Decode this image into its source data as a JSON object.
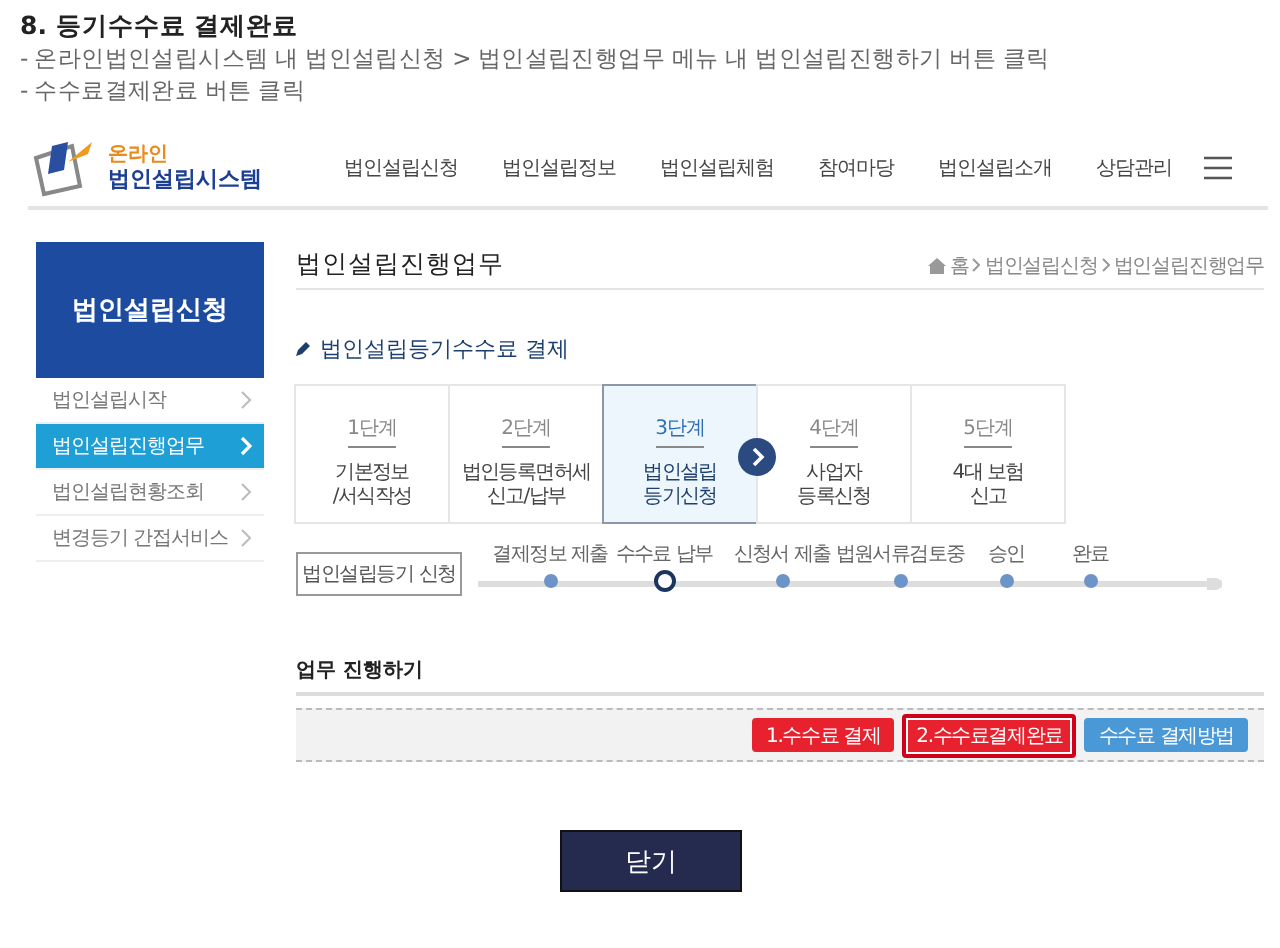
{
  "heading": "8. 등기수수료 결제완료",
  "instructions": [
    "- 온라인법인설립시스템 내 법인설립신청 > 법인설립진행업무 메뉴 내 법인설립진행하기 버튼 클릭",
    "- 수수료결제완료 버튼 클릭"
  ],
  "logo": {
    "top": "온라인",
    "bottom": "법인설립시스템"
  },
  "nav": [
    "법인설립신청",
    "법인설립정보",
    "법인설립체험",
    "참여마당",
    "법인설립소개",
    "상담관리"
  ],
  "sidebar": {
    "title": "법인설립신청",
    "items": [
      {
        "label": "법인설립시작",
        "selected": false
      },
      {
        "label": "법인설립진행업무",
        "selected": true
      },
      {
        "label": "법인설립현황조회",
        "selected": false
      },
      {
        "label": "변경등기 간접서비스",
        "selected": false
      }
    ]
  },
  "page_title": "법인설립진행업무",
  "breadcrumb": [
    "홈",
    "법인설립신청",
    "법인설립진행업무"
  ],
  "section_title": "법인설립등기수수료 결제",
  "steps": [
    {
      "number": "1단계",
      "label": [
        "기본정보",
        "/서식작성"
      ],
      "selected": false
    },
    {
      "number": "2단계",
      "label": [
        "법인등록면허세",
        "신고/납부"
      ],
      "selected": false
    },
    {
      "number": "3단계",
      "label": [
        "법인설립",
        "등기신청"
      ],
      "selected": true
    },
    {
      "number": "4단계",
      "label": [
        "사업자",
        "등록신청"
      ],
      "selected": false
    },
    {
      "number": "5단계",
      "label": [
        "4대 보험",
        "신고"
      ],
      "selected": false
    }
  ],
  "progress": {
    "button": "법인설립등기 신청",
    "stages": [
      {
        "label": "결제정보 제출",
        "current": false
      },
      {
        "label": "수수료 납부",
        "current": true
      },
      {
        "label": "신청서 제출",
        "current": false
      },
      {
        "label": "법원서류검토중",
        "current": false
      },
      {
        "label": "승인",
        "current": false
      },
      {
        "label": "완료",
        "current": false
      }
    ]
  },
  "task": {
    "title": "업무 진행하기",
    "buttons": [
      {
        "label": "1.수수료 결제",
        "color": "#e8212e",
        "highlighted": false
      },
      {
        "label": "2.수수료결제완료",
        "color": "#e8212e",
        "highlighted": true
      },
      {
        "label": "수수료 결제방법",
        "color": "#4a98d6",
        "highlighted": false
      }
    ]
  },
  "close_button": "닫기"
}
